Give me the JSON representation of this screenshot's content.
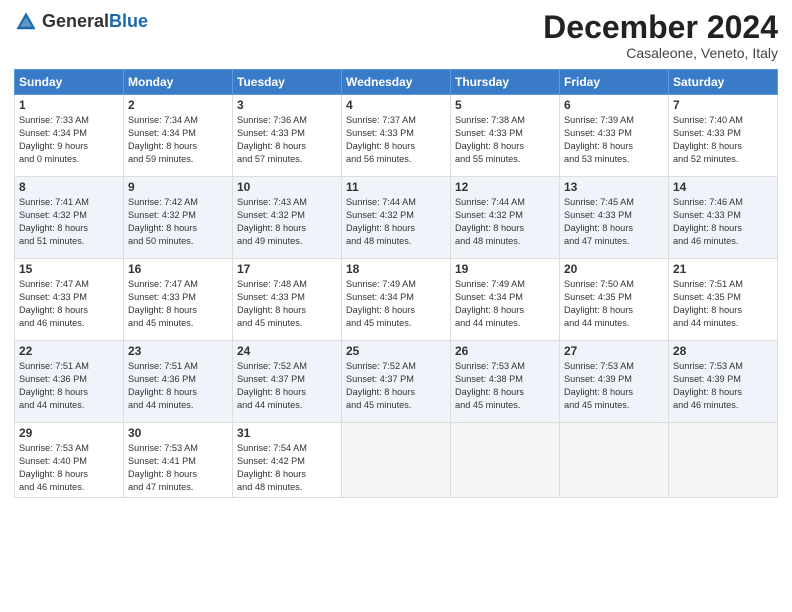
{
  "header": {
    "logo_general": "General",
    "logo_blue": "Blue",
    "month_title": "December 2024",
    "location": "Casaleone, Veneto, Italy"
  },
  "weekdays": [
    "Sunday",
    "Monday",
    "Tuesday",
    "Wednesday",
    "Thursday",
    "Friday",
    "Saturday"
  ],
  "weeks": [
    [
      {
        "day": "1",
        "info": "Sunrise: 7:33 AM\nSunset: 4:34 PM\nDaylight: 9 hours\nand 0 minutes."
      },
      {
        "day": "2",
        "info": "Sunrise: 7:34 AM\nSunset: 4:34 PM\nDaylight: 8 hours\nand 59 minutes."
      },
      {
        "day": "3",
        "info": "Sunrise: 7:36 AM\nSunset: 4:33 PM\nDaylight: 8 hours\nand 57 minutes."
      },
      {
        "day": "4",
        "info": "Sunrise: 7:37 AM\nSunset: 4:33 PM\nDaylight: 8 hours\nand 56 minutes."
      },
      {
        "day": "5",
        "info": "Sunrise: 7:38 AM\nSunset: 4:33 PM\nDaylight: 8 hours\nand 55 minutes."
      },
      {
        "day": "6",
        "info": "Sunrise: 7:39 AM\nSunset: 4:33 PM\nDaylight: 8 hours\nand 53 minutes."
      },
      {
        "day": "7",
        "info": "Sunrise: 7:40 AM\nSunset: 4:33 PM\nDaylight: 8 hours\nand 52 minutes."
      }
    ],
    [
      {
        "day": "8",
        "info": "Sunrise: 7:41 AM\nSunset: 4:32 PM\nDaylight: 8 hours\nand 51 minutes."
      },
      {
        "day": "9",
        "info": "Sunrise: 7:42 AM\nSunset: 4:32 PM\nDaylight: 8 hours\nand 50 minutes."
      },
      {
        "day": "10",
        "info": "Sunrise: 7:43 AM\nSunset: 4:32 PM\nDaylight: 8 hours\nand 49 minutes."
      },
      {
        "day": "11",
        "info": "Sunrise: 7:44 AM\nSunset: 4:32 PM\nDaylight: 8 hours\nand 48 minutes."
      },
      {
        "day": "12",
        "info": "Sunrise: 7:44 AM\nSunset: 4:32 PM\nDaylight: 8 hours\nand 48 minutes."
      },
      {
        "day": "13",
        "info": "Sunrise: 7:45 AM\nSunset: 4:33 PM\nDaylight: 8 hours\nand 47 minutes."
      },
      {
        "day": "14",
        "info": "Sunrise: 7:46 AM\nSunset: 4:33 PM\nDaylight: 8 hours\nand 46 minutes."
      }
    ],
    [
      {
        "day": "15",
        "info": "Sunrise: 7:47 AM\nSunset: 4:33 PM\nDaylight: 8 hours\nand 46 minutes."
      },
      {
        "day": "16",
        "info": "Sunrise: 7:47 AM\nSunset: 4:33 PM\nDaylight: 8 hours\nand 45 minutes."
      },
      {
        "day": "17",
        "info": "Sunrise: 7:48 AM\nSunset: 4:33 PM\nDaylight: 8 hours\nand 45 minutes."
      },
      {
        "day": "18",
        "info": "Sunrise: 7:49 AM\nSunset: 4:34 PM\nDaylight: 8 hours\nand 45 minutes."
      },
      {
        "day": "19",
        "info": "Sunrise: 7:49 AM\nSunset: 4:34 PM\nDaylight: 8 hours\nand 44 minutes."
      },
      {
        "day": "20",
        "info": "Sunrise: 7:50 AM\nSunset: 4:35 PM\nDaylight: 8 hours\nand 44 minutes."
      },
      {
        "day": "21",
        "info": "Sunrise: 7:51 AM\nSunset: 4:35 PM\nDaylight: 8 hours\nand 44 minutes."
      }
    ],
    [
      {
        "day": "22",
        "info": "Sunrise: 7:51 AM\nSunset: 4:36 PM\nDaylight: 8 hours\nand 44 minutes."
      },
      {
        "day": "23",
        "info": "Sunrise: 7:51 AM\nSunset: 4:36 PM\nDaylight: 8 hours\nand 44 minutes."
      },
      {
        "day": "24",
        "info": "Sunrise: 7:52 AM\nSunset: 4:37 PM\nDaylight: 8 hours\nand 44 minutes."
      },
      {
        "day": "25",
        "info": "Sunrise: 7:52 AM\nSunset: 4:37 PM\nDaylight: 8 hours\nand 45 minutes."
      },
      {
        "day": "26",
        "info": "Sunrise: 7:53 AM\nSunset: 4:38 PM\nDaylight: 8 hours\nand 45 minutes."
      },
      {
        "day": "27",
        "info": "Sunrise: 7:53 AM\nSunset: 4:39 PM\nDaylight: 8 hours\nand 45 minutes."
      },
      {
        "day": "28",
        "info": "Sunrise: 7:53 AM\nSunset: 4:39 PM\nDaylight: 8 hours\nand 46 minutes."
      }
    ],
    [
      {
        "day": "29",
        "info": "Sunrise: 7:53 AM\nSunset: 4:40 PM\nDaylight: 8 hours\nand 46 minutes."
      },
      {
        "day": "30",
        "info": "Sunrise: 7:53 AM\nSunset: 4:41 PM\nDaylight: 8 hours\nand 47 minutes."
      },
      {
        "day": "31",
        "info": "Sunrise: 7:54 AM\nSunset: 4:42 PM\nDaylight: 8 hours\nand 48 minutes."
      },
      {
        "day": "",
        "info": ""
      },
      {
        "day": "",
        "info": ""
      },
      {
        "day": "",
        "info": ""
      },
      {
        "day": "",
        "info": ""
      }
    ]
  ]
}
